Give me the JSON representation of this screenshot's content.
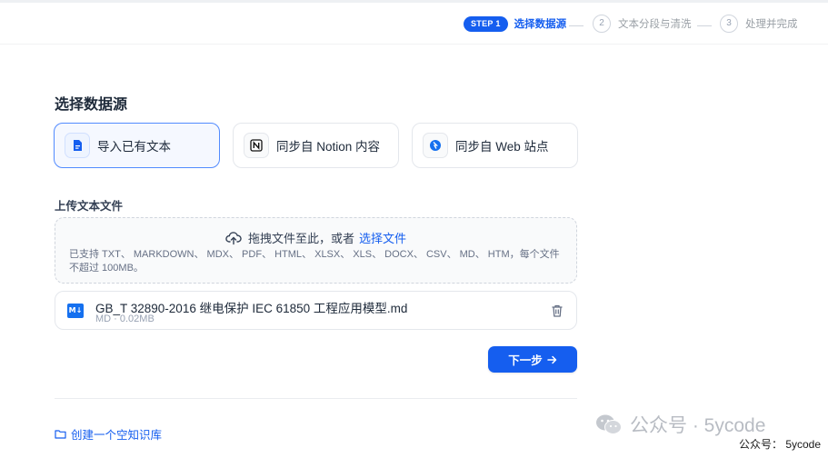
{
  "steps": [
    {
      "badge": "STEP 1",
      "label": "选择数据源",
      "active": true
    },
    {
      "num": "2",
      "label": "文本分段与清洗"
    },
    {
      "num": "3",
      "label": "处理并完成"
    }
  ],
  "section_title": "选择数据源",
  "sources": [
    {
      "label": "导入已有文本",
      "icon": "document-icon",
      "selected": true
    },
    {
      "label": "同步自 Notion 内容",
      "icon": "notion-icon"
    },
    {
      "label": "同步自 Web 站点",
      "icon": "web-icon"
    }
  ],
  "upload": {
    "title": "上传文本文件",
    "drag_text": "拖拽文件至此，或者",
    "choose_link": "选择文件",
    "hint": "已支持 TXT、 MARKDOWN、 MDX、 PDF、 HTML、 XLSX、 XLS、 DOCX、 CSV、 MD、 HTM，每个文件不超过 100MB。"
  },
  "file": {
    "icon_text": "M↓",
    "name": "GB_T 32890-2016 继电保护 IEC 61850 工程应用模型.md",
    "meta": "MD · 0.02MB"
  },
  "next_button": "下一步",
  "create_empty": "创建一个空知识库",
  "watermark": {
    "text": "公众号 · 5ycode",
    "small": "公众号： 5ycode"
  },
  "colors": {
    "primary": "#155eef",
    "border": "#e4e7ec",
    "muted": "#98a2b3"
  }
}
